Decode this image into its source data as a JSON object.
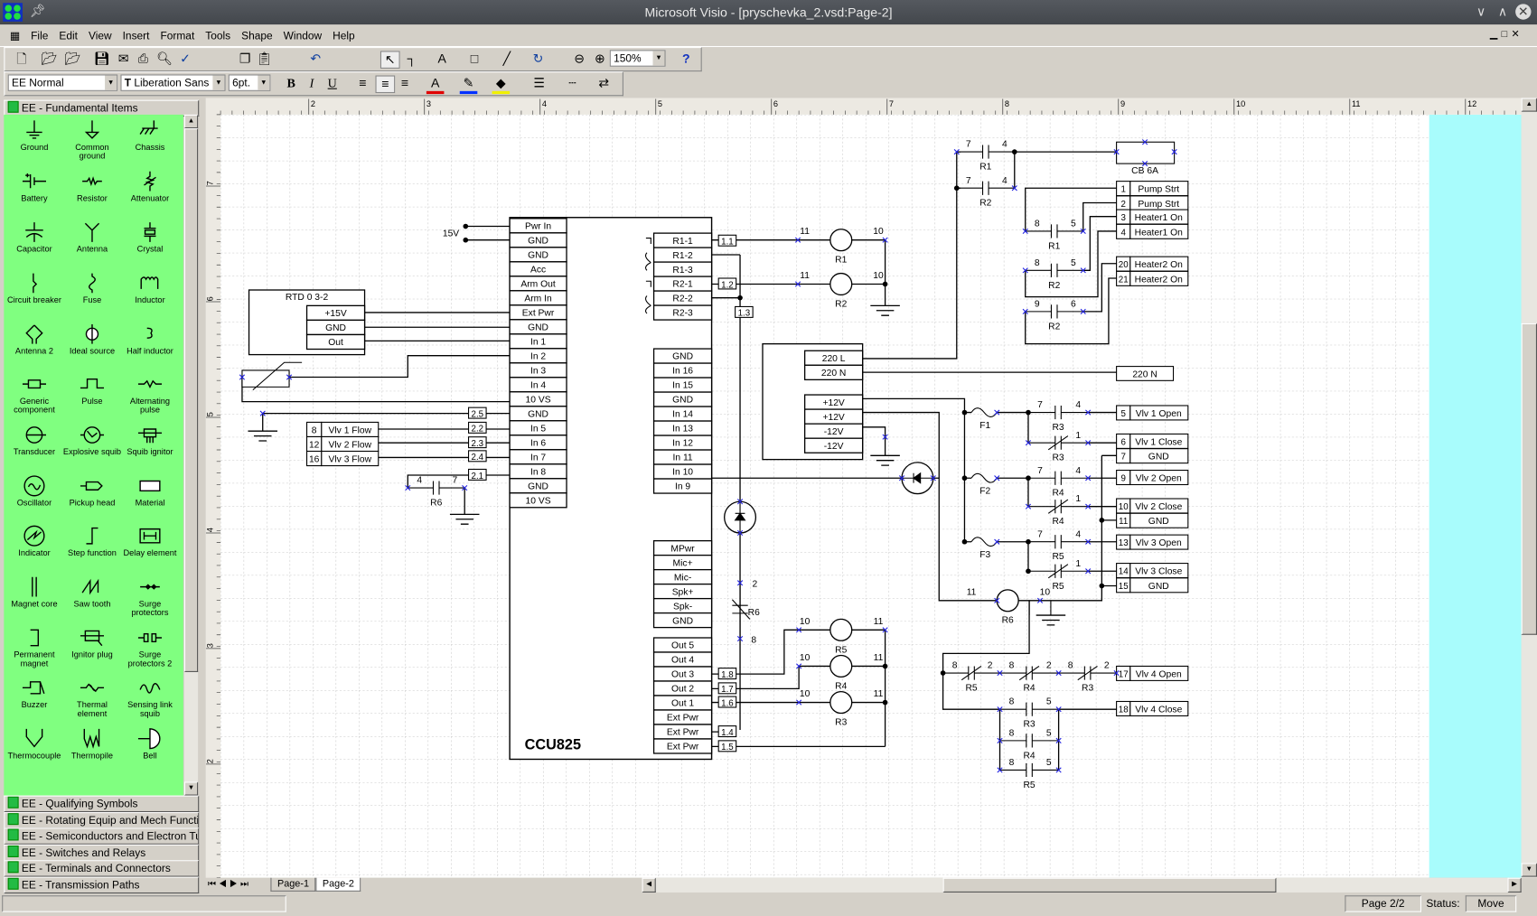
{
  "window": {
    "title": "Microsoft Visio - [pryschevka_2.vsd:Page-2]"
  },
  "menu": [
    "File",
    "Edit",
    "View",
    "Insert",
    "Format",
    "Tools",
    "Shape",
    "Window",
    "Help"
  ],
  "toolbar": {
    "style": "EE Normal",
    "font": "Liberation Sans",
    "size": "6pt.",
    "zoom": "150%",
    "help": "?"
  },
  "stencil": {
    "title": "EE - Fundamental Items",
    "shapes": [
      "Ground",
      "Common ground",
      "Chassis",
      "Battery",
      "Resistor",
      "Attenuator",
      "Capacitor",
      "Antenna",
      "Crystal",
      "Circuit breaker",
      "Fuse",
      "Inductor",
      "Antenna 2",
      "Ideal source",
      "Half inductor",
      "Generic component",
      "Pulse",
      "Alternating pulse",
      "Transducer",
      "Explosive squib",
      "Squib ignitor",
      "Oscillator",
      "Pickup head",
      "Material",
      "Indicator",
      "Step function",
      "Delay element",
      "Magnet core",
      "Saw tooth",
      "Surge protectors",
      "Permanent magnet",
      "Ignitor plug",
      "Surge protectors 2",
      "Buzzer",
      "Thermal element",
      "Sensing link squib",
      "Thermocouple",
      "Thermopile",
      "Bell"
    ],
    "collapsed": [
      "EE - Qualifying Symbols",
      "EE - Rotating Equip and Mech Functions",
      "EE - Semiconductors and Electron Tube",
      "EE - Switches and Relays",
      "EE - Terminals and Connectors",
      "EE - Transmission Paths"
    ]
  },
  "ruler": {
    "h": [
      "2",
      "3",
      "4",
      "5",
      "6",
      "7",
      "8",
      "9",
      "10",
      "11",
      "12"
    ],
    "v": [
      "7",
      "6",
      "5",
      "4",
      "3",
      "2"
    ]
  },
  "diagram": {
    "supply_label": "15V",
    "ccu": {
      "name": "CCU825",
      "left_pins": [
        "Pwr In",
        "GND",
        "GND",
        "Acc",
        "Arm Out",
        "Arm In",
        "Ext Pwr",
        "GND",
        "In 1",
        "In 2",
        "In 3",
        "In 4",
        "10 VS",
        "GND",
        "In 5",
        "In 6",
        "In 7",
        "In 8",
        "GND",
        "10 VS"
      ],
      "relay_pins": [
        "R1-1",
        "R1-2",
        "R1-3",
        "R2-1",
        "R2-2",
        "R2-3"
      ],
      "inputs": [
        "GND",
        "In 16",
        "In 15",
        "GND",
        "In 14",
        "In 13",
        "In 12",
        "In 11",
        "In 10",
        "In 9"
      ],
      "audio": [
        "MPwr",
        "Mic+",
        "Mic-",
        "Spk+",
        "Spk-",
        "GND"
      ],
      "outputs": [
        "Out 5",
        "Out 4",
        "Out 3",
        "Out 2",
        "Out 1",
        "Ext Pwr",
        "Ext Pwr",
        "Ext Pwr"
      ]
    },
    "rtd": {
      "name": "RTD 0 3-2",
      "pins": [
        "+15V",
        "GND",
        "Out"
      ]
    },
    "flow": [
      [
        "8",
        "Vlv 1 Flow"
      ],
      [
        "12",
        "Vlv 2 Flow"
      ],
      [
        "16",
        "Vlv 3 Flow"
      ]
    ],
    "tags": [
      "1.1",
      "1.2",
      "1.3",
      "2.5",
      "2.2",
      "2.3",
      "2.4",
      "2.1",
      "1.8",
      "1.7",
      "1.6",
      "1.4",
      "1.5"
    ],
    "psu": {
      "ac": [
        "220 L",
        "220 N"
      ],
      "dc": [
        "+12V",
        "+12V",
        "-12V",
        "-12V"
      ]
    },
    "neutral_terminal": "220 N",
    "breaker": "CB 6A",
    "terminals": [
      [
        "1",
        "Pump Strt"
      ],
      [
        "2",
        "Pump Strt"
      ],
      [
        "3",
        "Heater1 On"
      ],
      [
        "4",
        "Heater1 On"
      ],
      [
        "20",
        "Heater2 On"
      ],
      [
        "21",
        "Heater2 On"
      ],
      [
        "5",
        "Vlv 1 Open"
      ],
      [
        "6",
        "Vlv 1 Close"
      ],
      [
        "7",
        "GND"
      ],
      [
        "9",
        "Vlv 2 Open"
      ],
      [
        "10",
        "Vlv 2 Close"
      ],
      [
        "11",
        "GND"
      ],
      [
        "13",
        "Vlv 3 Open"
      ],
      [
        "14",
        "Vlv 3 Close"
      ],
      [
        "15",
        "GND"
      ],
      [
        "17",
        "Vlv 4 Open"
      ],
      [
        "18",
        "Vlv 4 Close"
      ]
    ],
    "contacts": [
      {
        "name": "R1",
        "a": "7",
        "b": "4"
      },
      {
        "name": "R2",
        "a": "7",
        "b": "4"
      },
      {
        "name": "R1",
        "a": "8",
        "b": "5"
      },
      {
        "name": "R2",
        "a": "8",
        "b": "5"
      },
      {
        "name": "R2",
        "a": "9",
        "b": "6"
      },
      {
        "name": "R3",
        "a": "7",
        "b": "4"
      },
      {
        "name": "R3",
        "a": "",
        "b": "1"
      },
      {
        "name": "R4",
        "a": "7",
        "b": "4"
      },
      {
        "name": "R4",
        "a": "",
        "b": "1"
      },
      {
        "name": "R5",
        "a": "7",
        "b": "4"
      },
      {
        "name": "R5",
        "a": "",
        "b": "1"
      },
      {
        "name": "R6",
        "a": "4",
        "b": "7"
      },
      {
        "name": "R5",
        "a": "8",
        "b": "2"
      },
      {
        "name": "R4",
        "a": "8",
        "b": "2"
      },
      {
        "name": "R3",
        "a": "8",
        "b": "2"
      },
      {
        "name": "R3",
        "a": "8",
        "b": "5"
      },
      {
        "name": "R4",
        "a": "8",
        "b": "5"
      },
      {
        "name": "R5",
        "a": "8",
        "b": "5"
      },
      {
        "name": "R6",
        "a": "2",
        "b": "8"
      }
    ],
    "coils": [
      {
        "name": "R1",
        "a": "11",
        "b": "10"
      },
      {
        "name": "R2",
        "a": "11",
        "b": "10"
      },
      {
        "name": "R6",
        "a": "11",
        "b": "10"
      },
      {
        "name": "R5",
        "a": "10",
        "b": "11"
      },
      {
        "name": "R4",
        "a": "10",
        "b": "11"
      },
      {
        "name": "R3",
        "a": "10",
        "b": "11"
      }
    ],
    "fuses": [
      "F1",
      "F2",
      "F3"
    ]
  },
  "pages": [
    "Page-1",
    "Page-2"
  ],
  "status": {
    "page": "Page 2/2",
    "label": "Status:",
    "value": "Move"
  }
}
